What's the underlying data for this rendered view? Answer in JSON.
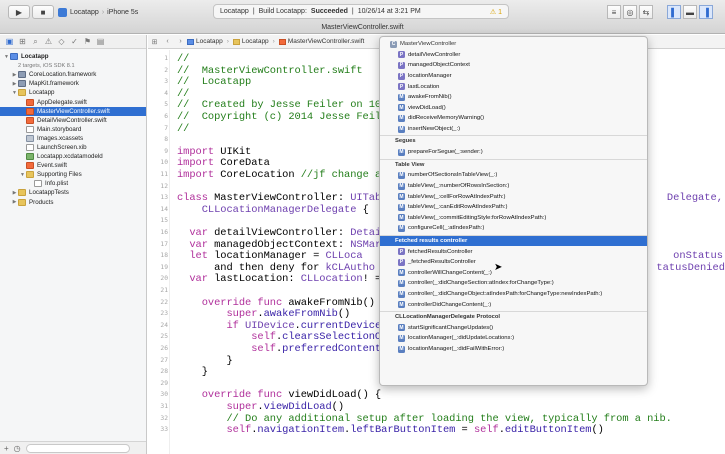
{
  "toolbar": {
    "run_glyph": "▶",
    "stop_glyph": "■",
    "scheme": "Locatapp",
    "separator": "›",
    "device": "iPhone 5s",
    "status_project": "Locatapp",
    "status_divider": "|",
    "status_build_label": "Build Locatapp:",
    "status_build_result": "Succeeded",
    "status_time": "10/26/14 at 3:21 PM",
    "status_warning": "⚠ 1",
    "editor_mode_glyphs": [
      "≡",
      "◎",
      "⇆"
    ],
    "view_glyphs": [
      "▌",
      "▬",
      "▐"
    ]
  },
  "window": {
    "title": "MasterViewController.swift"
  },
  "navigator": {
    "tab_glyphs": [
      "▣",
      "⊞",
      "⌕",
      "⚠",
      "◇",
      "✓",
      "⚑",
      "▤"
    ],
    "rows": [
      {
        "label": "Locatapp",
        "sub": "",
        "depth": 0,
        "icon": "proj",
        "tri": "▼",
        "bold": true
      },
      {
        "label": "2 targets, iOS SDK 8.1",
        "sub": "",
        "depth": 1,
        "icon": "",
        "tri": "",
        "small": true
      },
      {
        "label": "CoreLocation.framework",
        "depth": 1,
        "icon": "tool",
        "tri": "▶"
      },
      {
        "label": "MapKit.framework",
        "depth": 1,
        "icon": "tool",
        "tri": "▶"
      },
      {
        "label": "Locatapp",
        "depth": 1,
        "icon": "folder",
        "tri": "▼"
      },
      {
        "label": "AppDelegate.swift",
        "depth": 2,
        "icon": "swift",
        "tri": ""
      },
      {
        "label": "MasterViewController.swift",
        "depth": 2,
        "icon": "swift",
        "tri": "",
        "selected": true
      },
      {
        "label": "DetailViewController.swift",
        "depth": 2,
        "icon": "swift",
        "tri": ""
      },
      {
        "label": "Main.storyboard",
        "depth": 2,
        "icon": "file",
        "tri": ""
      },
      {
        "label": "Images.xcassets",
        "depth": 2,
        "icon": "assets",
        "tri": ""
      },
      {
        "label": "LaunchScreen.xib",
        "depth": 2,
        "icon": "file",
        "tri": ""
      },
      {
        "label": "Locatapp.xcdatamodeld",
        "depth": 2,
        "icon": "data",
        "tri": ""
      },
      {
        "label": "Event.swift",
        "depth": 2,
        "icon": "swift",
        "tri": ""
      },
      {
        "label": "Supporting Files",
        "depth": 2,
        "icon": "folder",
        "tri": "▼"
      },
      {
        "label": "Info.plist",
        "depth": 3,
        "icon": "file",
        "tri": ""
      },
      {
        "label": "LocatappTests",
        "depth": 1,
        "icon": "folder",
        "tri": "▶"
      },
      {
        "label": "Products",
        "depth": 1,
        "icon": "folder",
        "tri": "▶"
      }
    ],
    "filter_plus": "+",
    "filter_clock": "◷"
  },
  "jumpbar": {
    "grid_glyph": "⊞",
    "back_glyph": "‹",
    "forward_glyph": "›",
    "crumbs": [
      "Locatapp",
      "Locatapp",
      "MasterViewController.swift"
    ],
    "chevron": "›"
  },
  "code_lines": [
    {
      "n": 1,
      "t": [
        [
          "cm",
          "//"
        ]
      ]
    },
    {
      "n": 2,
      "t": [
        [
          "cm",
          "//  MasterViewController.swift"
        ]
      ]
    },
    {
      "n": 3,
      "t": [
        [
          "cm",
          "//  Locatapp"
        ]
      ]
    },
    {
      "n": 4,
      "t": [
        [
          "cm",
          "//"
        ]
      ]
    },
    {
      "n": 5,
      "t": [
        [
          "cm",
          "//  Created by Jesse Feiler on 10"
        ]
      ]
    },
    {
      "n": 6,
      "t": [
        [
          "cm",
          "//  Copyright (c) 2014 Jesse Feil"
        ]
      ]
    },
    {
      "n": 7,
      "t": [
        [
          "cm",
          "//"
        ]
      ]
    },
    {
      "n": 8,
      "t": []
    },
    {
      "n": 9,
      "t": [
        [
          "kw",
          "import"
        ],
        [
          "",
          " UIKit"
        ]
      ]
    },
    {
      "n": 10,
      "t": [
        [
          "kw",
          "import"
        ],
        [
          "",
          " CoreData"
        ]
      ]
    },
    {
      "n": 11,
      "t": [
        [
          "kw",
          "import"
        ],
        [
          "",
          " CoreLocation "
        ],
        [
          "cm",
          "//jf change a"
        ]
      ]
    },
    {
      "n": 12,
      "t": []
    },
    {
      "n": 13,
      "t": [
        [
          "kw",
          "class"
        ],
        [
          "",
          " MasterViewController: "
        ],
        [
          "ty",
          "UITab"
        ]
      ]
    },
    {
      "n": 14,
      "t": [
        [
          "ty",
          "    CLLocationManagerDelegate"
        ],
        [
          "",
          " {"
        ]
      ]
    },
    {
      "n": 15,
      "t": []
    },
    {
      "n": 16,
      "t": [
        [
          "kw",
          "  var"
        ],
        [
          "",
          " detailViewController: "
        ],
        [
          "ty",
          "Detai"
        ]
      ]
    },
    {
      "n": 17,
      "t": [
        [
          "kw",
          "  var"
        ],
        [
          "",
          " managedObjectContext: "
        ],
        [
          "ty",
          "NSMar"
        ]
      ]
    },
    {
      "n": 18,
      "t": [
        [
          "kw",
          "  let"
        ],
        [
          "",
          " locationManager = "
        ],
        [
          "ty",
          "CLLoca"
        ]
      ]
    },
    {
      "n": 19,
      "t": [
        [
          "",
          "      and then deny for "
        ],
        [
          "ty",
          "kCLAutho"
        ]
      ]
    },
    {
      "n": 20,
      "t": [
        [
          "kw",
          "  var"
        ],
        [
          "",
          " lastLocation: "
        ],
        [
          "ty",
          "CLLocation"
        ],
        [
          "",
          "! ="
        ]
      ]
    },
    {
      "n": 21,
      "t": []
    },
    {
      "n": 22,
      "t": [
        [
          "kw",
          "    override func"
        ],
        [
          "",
          " awakeFromNib()"
        ]
      ]
    },
    {
      "n": 23,
      "t": [
        [
          "kw",
          "        super"
        ],
        [
          "",
          "."
        ],
        [
          "fn",
          "awakeFromNib"
        ],
        [
          "",
          "()"
        ]
      ]
    },
    {
      "n": 24,
      "t": [
        [
          "kw",
          "        if"
        ],
        [
          "",
          " "
        ],
        [
          "ty",
          "UIDevice"
        ],
        [
          "",
          "."
        ],
        [
          "fn",
          "currentDevice"
        ]
      ]
    },
    {
      "n": 25,
      "t": [
        [
          "kw",
          "            self"
        ],
        [
          "",
          "."
        ],
        [
          "fn",
          "clearsSelectionO"
        ]
      ]
    },
    {
      "n": 26,
      "t": [
        [
          "kw",
          "            self"
        ],
        [
          "",
          "."
        ],
        [
          "fn",
          "preferredContent"
        ]
      ]
    },
    {
      "n": 27,
      "t": [
        [
          "",
          "        }"
        ]
      ]
    },
    {
      "n": 28,
      "t": [
        [
          "",
          "    }"
        ]
      ]
    },
    {
      "n": 29,
      "t": []
    },
    {
      "n": 30,
      "t": [
        [
          "kw",
          "    override func"
        ],
        [
          "",
          " viewDidLoad() {"
        ]
      ]
    },
    {
      "n": 31,
      "t": [
        [
          "kw",
          "        super"
        ],
        [
          "",
          "."
        ],
        [
          "fn",
          "viewDidLoad"
        ],
        [
          "",
          "()"
        ]
      ]
    },
    {
      "n": 32,
      "t": [
        [
          "cm",
          "        // Do any additional setup after loading the view, typically from a nib."
        ]
      ]
    },
    {
      "n": 33,
      "t": [
        [
          "kw",
          "        self"
        ],
        [
          "",
          "."
        ],
        [
          "fn",
          "navigationItem"
        ],
        [
          "",
          "."
        ],
        [
          "fn",
          "leftBarButtonItem"
        ],
        [
          "",
          " = "
        ],
        [
          "kw",
          "self"
        ],
        [
          "",
          "."
        ],
        [
          "fn",
          "editButtonItem"
        ],
        [
          "",
          "()"
        ]
      ]
    }
  ],
  "code_right_fragments": [
    {
      "line": 13,
      "text": "Delegate,"
    },
    {
      "line": 18,
      "text": "onStatus"
    },
    {
      "line": 19,
      "text": "tatusDenied"
    }
  ],
  "popup": {
    "class_title": "MasterViewController",
    "items_main": [
      "detailViewController",
      "managedObjectContext",
      "locationManager",
      "lastLocation",
      "awakeFromNib()",
      "viewDidLoad()",
      "didReceiveMemoryWarning()",
      "insertNewObject(_:)"
    ],
    "section_segues": "Segues",
    "items_segues": [
      "prepareForSegue(_:sender:)"
    ],
    "section_table": "Table View",
    "items_table": [
      "numberOfSectionsInTableView(_:)",
      "tableView(_:numberOfRowsInSection:)",
      "tableView(_:cellForRowAtIndexPath:)",
      "tableView(_:canEditRowAtIndexPath:)",
      "tableView(_:commitEditingStyle:forRowAtIndexPath:)",
      "configureCell(_:atIndexPath:)"
    ],
    "section_frc": "Fetched results controller",
    "items_frc": [
      "fetchedResultsController",
      "_fetchedResultsController",
      "controllerWillChangeContent(_:)",
      "controller(_:didChangeSection:atIndex:forChangeType:)",
      "controller(_:didChangeObject:atIndexPath:forChangeType:newIndexPath:)",
      "controllerDidChangeContent(_:)"
    ],
    "section_cl": "CLLocationManagerDelegate Protocol",
    "items_cl": [
      "startSignificantChangeUpdates()",
      "locationManager(_:didUpdateLocations:)",
      "locationManager(_:didFailWithError:)"
    ],
    "badge_letter_c": "C",
    "badge_letter_p": "P",
    "badge_letter_m": "M"
  },
  "colors": {
    "accent": "#2f6fd1",
    "comment": "#237e1a",
    "keyword": "#b0309b",
    "type": "#6d3fae"
  }
}
